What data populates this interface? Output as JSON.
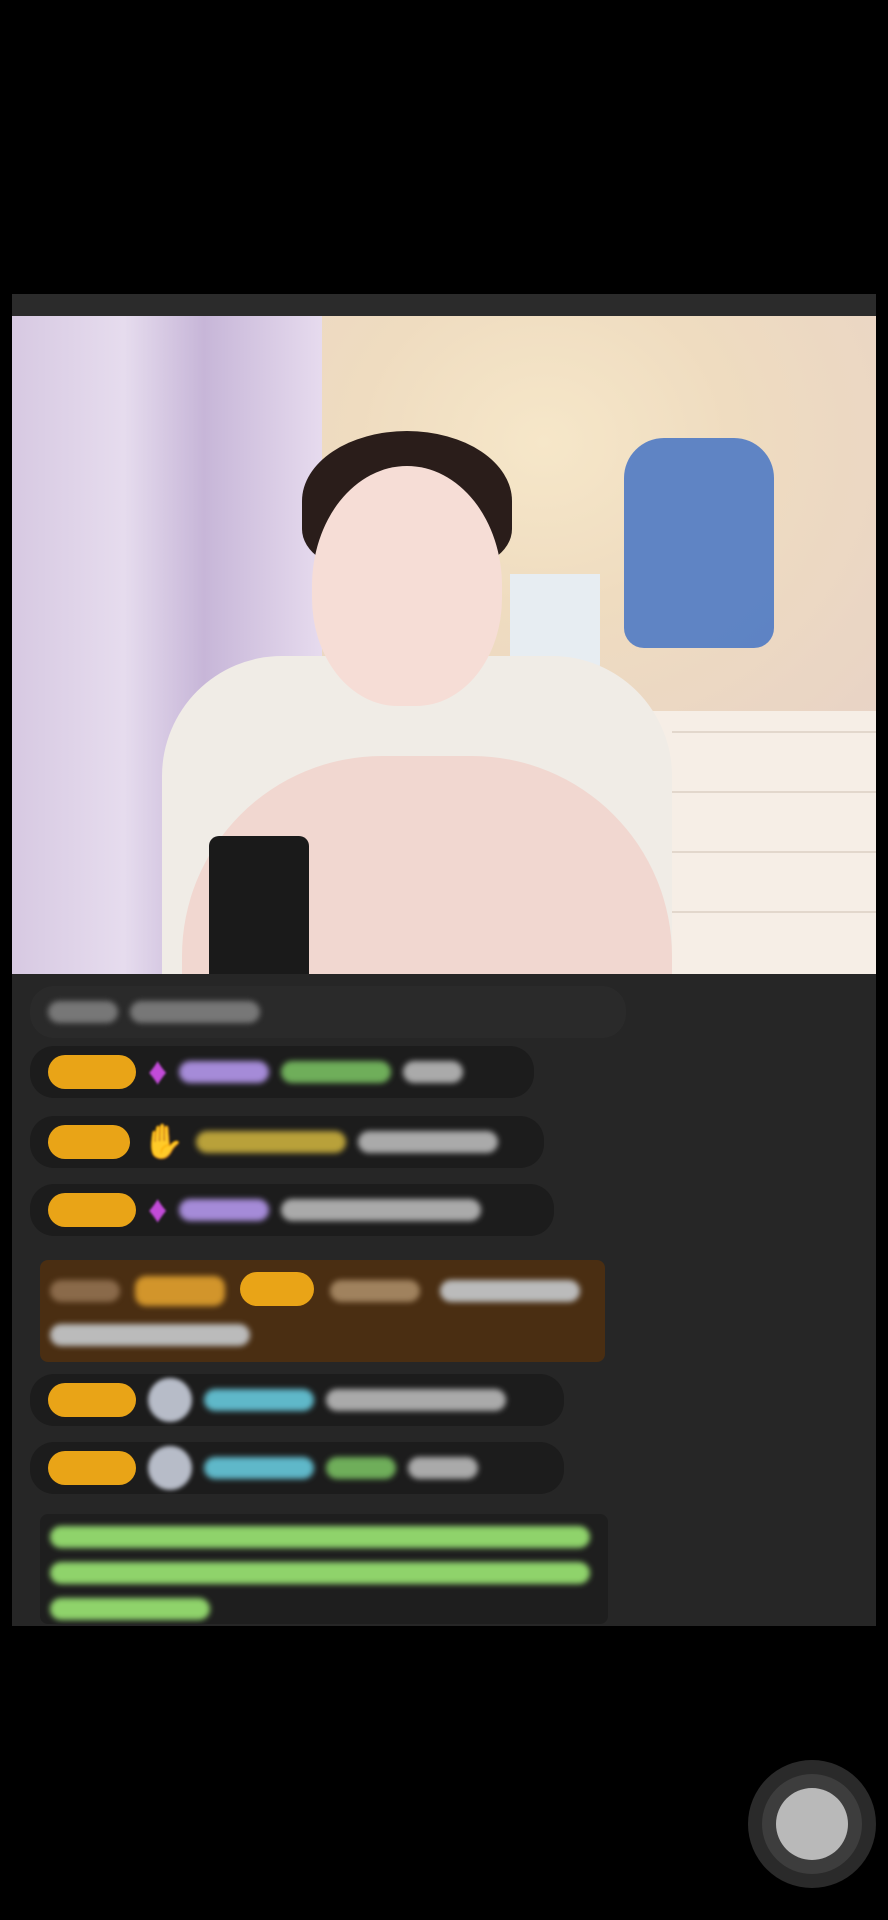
{
  "stream": {
    "scene": "live-stream-video",
    "colors": {
      "background": "#000000",
      "panel": "#262626",
      "badge": "#e9a417",
      "highlight_row": "#4a2e12",
      "text_green": "#8fd36b",
      "text_teal": "#5fb8c9",
      "text_purple": "#b393e0"
    }
  },
  "chat": {
    "messages_blurred": true
  },
  "controls": {
    "record_button_icon": "circle-button-icon"
  }
}
